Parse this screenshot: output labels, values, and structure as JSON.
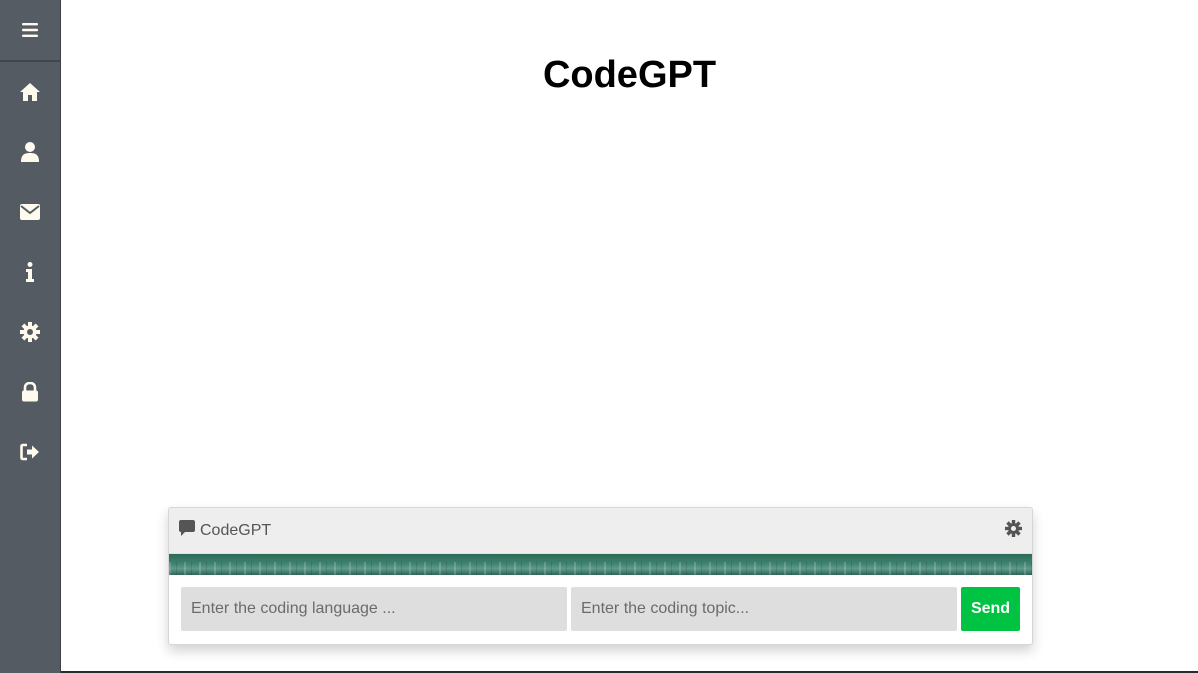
{
  "page": {
    "title": "CodeGPT"
  },
  "sidebar": {
    "toggle_icon": "hamburger-menu-icon",
    "items": [
      {
        "id": "home",
        "icon": "home-icon"
      },
      {
        "id": "profile",
        "icon": "user-icon"
      },
      {
        "id": "messages",
        "icon": "envelope-icon"
      },
      {
        "id": "info",
        "icon": "info-icon"
      },
      {
        "id": "settings",
        "icon": "gear-icon"
      },
      {
        "id": "security",
        "icon": "lock-icon"
      },
      {
        "id": "logout",
        "icon": "sign-out-icon"
      }
    ],
    "icon_color": "#fffaee",
    "background": "#545b62"
  },
  "chat": {
    "title": "CodeGPT",
    "language_placeholder": "Enter the coding language ...",
    "topic_placeholder": "Enter the coding topic...",
    "send_label": "Send",
    "send_color": "#00c243"
  }
}
